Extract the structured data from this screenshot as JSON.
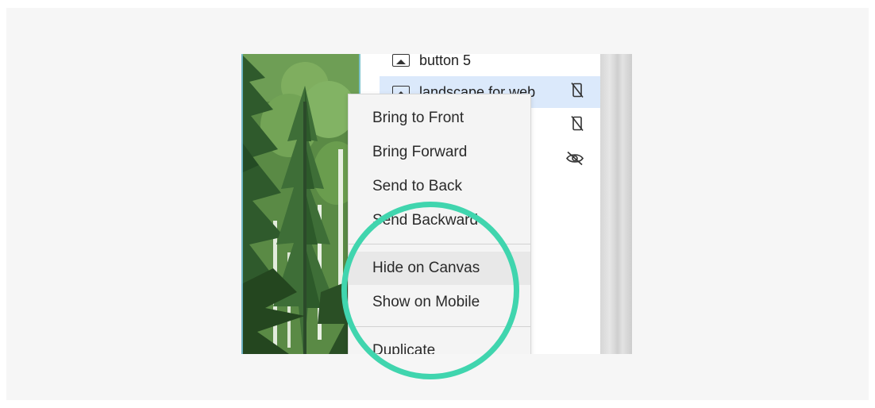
{
  "layers_panel": {
    "items": [
      {
        "label": "button 5",
        "icon": "image-layer-icon",
        "selected": false,
        "status_icon": ""
      },
      {
        "label": "landscape for web",
        "icon": "image-layer-icon",
        "selected": true,
        "status_icon": "mobile-hidden-icon"
      },
      {
        "label": "",
        "icon": "",
        "selected": false,
        "status_icon": "mobile-hidden-icon"
      },
      {
        "label": "",
        "icon": "",
        "selected": false,
        "status_icon": "eye-hidden-icon"
      }
    ]
  },
  "context_menu": {
    "items": [
      {
        "label": "Bring to Front"
      },
      {
        "label": "Bring Forward"
      },
      {
        "label": "Send to Back"
      },
      {
        "label": "Send Backward"
      },
      {
        "label": "Hide on Canvas",
        "hovered": true
      },
      {
        "label": "Show on Mobile"
      },
      {
        "label": "Duplicate"
      }
    ]
  },
  "colors": {
    "highlight_ring": "#40d5ae",
    "selected_row": "#dbe9fb",
    "menu_bg": "#f4f4f4"
  }
}
